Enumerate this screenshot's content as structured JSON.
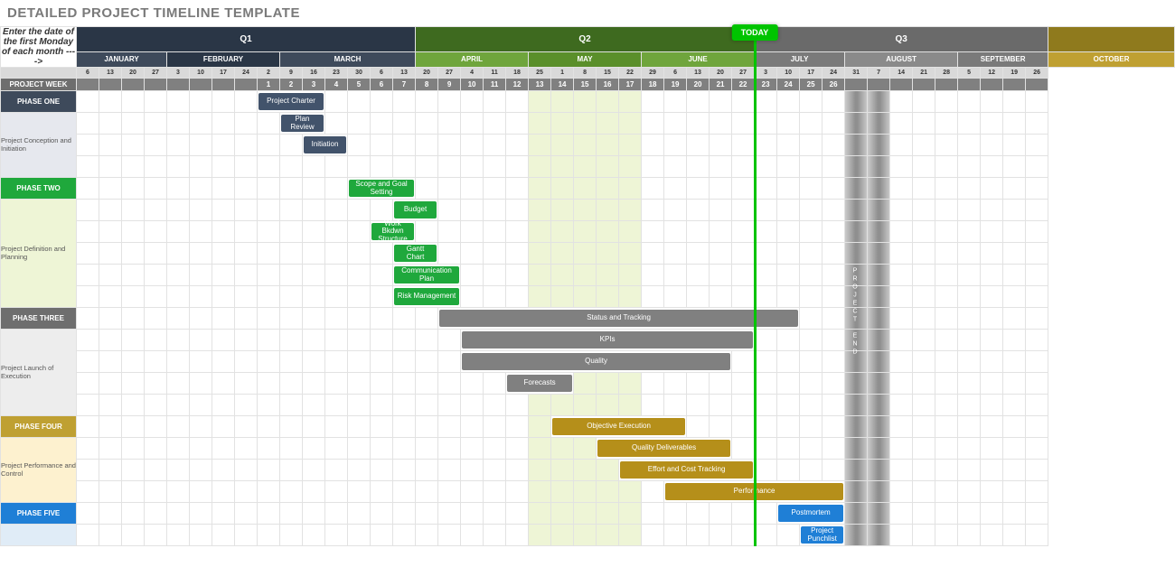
{
  "title": "DETAILED PROJECT TIMELINE TEMPLATE",
  "note": "Enter the date of the first Monday of each month ---->",
  "today": "TODAY",
  "project_week_label": "PROJECT WEEK",
  "project_end_label": "PROJECT END",
  "colors": {
    "q1": "#2a3646",
    "q2": "#3e6a1f",
    "q3": "#6a6a6a",
    "q4": "#8f7a1d",
    "m_jan": "#3e4a5b",
    "m_feb": "#2a3646",
    "m_mar": "#3e4a5b",
    "m_apr": "#6fa53c",
    "m_may": "#5a8f2a",
    "m_jun": "#6fa53c",
    "m_jul": "#7a7a7a",
    "m_aug": "#8a8a8a",
    "m_sep": "#7a7a7a",
    "m_oct": "#bfa032",
    "phase1": "#3e4a5b",
    "phase2": "#1fa83c",
    "phase3": "#6e6e6e",
    "phase4": "#bfa032",
    "phase5": "#1f7fd6",
    "bar_p1": "#42536b",
    "bar_p2": "#1fa83c",
    "bar_p3": "#808080",
    "bar_p4": "#b58f1a",
    "bar_p5": "#1f7fd6"
  },
  "quarters": [
    {
      "label": "Q1",
      "span": 15
    },
    {
      "label": "Q2",
      "span": 15
    },
    {
      "label": "Q3",
      "span": 13
    },
    {
      "label": "",
      "span": 4
    }
  ],
  "months": [
    {
      "label": "JANUARY",
      "span": 4,
      "c": "m_jan"
    },
    {
      "label": "FEBRUARY",
      "span": 5,
      "c": "m_feb"
    },
    {
      "label": "MARCH",
      "span": 6,
      "c": "m_mar"
    },
    {
      "label": "APRIL",
      "span": 5,
      "c": "m_apr"
    },
    {
      "label": "MAY",
      "span": 5,
      "c": "m_may"
    },
    {
      "label": "JUNE",
      "span": 5,
      "c": "m_jun"
    },
    {
      "label": "JULY",
      "span": 4,
      "c": "m_jul"
    },
    {
      "label": "AUGUST",
      "span": 5,
      "c": "m_aug"
    },
    {
      "label": "SEPTEMBER",
      "span": 4,
      "c": "m_sep"
    },
    {
      "label": "OCTOBER",
      "span": 4,
      "c": "m_oct"
    }
  ],
  "weeks": [
    "6",
    "13",
    "20",
    "27",
    "3",
    "10",
    "17",
    "24",
    "2",
    "9",
    "16",
    "23",
    "30",
    "6",
    "13",
    "20",
    "27",
    "4",
    "11",
    "18",
    "25",
    "1",
    "8",
    "15",
    "22",
    "29",
    "6",
    "13",
    "20",
    "27",
    "3",
    "10",
    "17",
    "24",
    "31",
    "7",
    "14",
    "21",
    "28",
    "5",
    "12",
    "19",
    "26"
  ],
  "project_weeks": [
    "",
    "",
    "",
    "",
    "",
    "",
    "",
    "",
    "1",
    "2",
    "3",
    "4",
    "5",
    "6",
    "7",
    "8",
    "9",
    "10",
    "11",
    "12",
    "13",
    "14",
    "15",
    "16",
    "17",
    "18",
    "19",
    "20",
    "21",
    "22",
    "23",
    "24",
    "25",
    "26",
    "",
    "",
    "",
    "",
    "",
    "",
    "",
    "",
    "",
    "",
    "",
    "",
    ""
  ],
  "phases": [
    {
      "name": "PHASE ONE",
      "sub": "Project Conception and Initiation",
      "style": "phase1",
      "sub_bg": "#e6e8ee",
      "tasks": [
        {
          "label": "Project Charter",
          "start": 8,
          "span": 3,
          "c": "bar_p1"
        },
        {
          "label": "Plan Review",
          "start": 9,
          "span": 2,
          "c": "bar_p1"
        },
        {
          "label": "Initiation",
          "start": 10,
          "span": 2,
          "c": "bar_p1"
        }
      ],
      "trailing": 1
    },
    {
      "name": "PHASE TWO",
      "sub": "Project Definition and Planning",
      "style": "phase2",
      "sub_bg": "#eef5d6",
      "tasks": [
        {
          "label": "Scope and Goal Setting",
          "start": 12,
          "span": 3,
          "c": "bar_p2"
        },
        {
          "label": "Budget",
          "start": 14,
          "span": 2,
          "c": "bar_p2"
        },
        {
          "label": "Work Bkdwn Structure",
          "start": 13,
          "span": 2,
          "c": "bar_p2"
        },
        {
          "label": "Gantt Chart",
          "start": 14,
          "span": 2,
          "c": "bar_p2"
        },
        {
          "label": "Communication Plan",
          "start": 14,
          "span": 3,
          "c": "bar_p2"
        },
        {
          "label": "Risk Management",
          "start": 14,
          "span": 3,
          "c": "bar_p2"
        }
      ],
      "trailing": 0
    },
    {
      "name": "PHASE THREE",
      "sub": "Project Launch of Execution",
      "style": "phase3",
      "sub_bg": "#ededed",
      "tasks": [
        {
          "label": "Status and Tracking",
          "start": 16,
          "span": 16,
          "c": "bar_p3"
        },
        {
          "label": "KPIs",
          "start": 17,
          "span": 13,
          "c": "bar_p3"
        },
        {
          "label": "Quality",
          "start": 17,
          "span": 12,
          "c": "bar_p3"
        },
        {
          "label": "Forecasts",
          "start": 19,
          "span": 3,
          "c": "bar_p3"
        }
      ],
      "trailing": 1
    },
    {
      "name": "PHASE FOUR",
      "sub": "Project Performance and Control",
      "style": "phase4",
      "sub_bg": "#fdf1cf",
      "tasks": [
        {
          "label": "Objective Execution",
          "start": 21,
          "span": 6,
          "c": "bar_p4"
        },
        {
          "label": "Quality Deliverables",
          "start": 23,
          "span": 6,
          "c": "bar_p4"
        },
        {
          "label": "Effort and Cost Tracking",
          "start": 24,
          "span": 6,
          "c": "bar_p4"
        },
        {
          "label": "Performance",
          "start": 26,
          "span": 8,
          "c": "bar_p4"
        }
      ],
      "trailing": 0
    },
    {
      "name": "PHASE FIVE",
      "sub": "",
      "style": "phase5",
      "sub_bg": "#e0ecf7",
      "tasks": [
        {
          "label": "Postmortem",
          "start": 31,
          "span": 3,
          "c": "bar_p5"
        },
        {
          "label": "Project Punchlist",
          "start": 32,
          "span": 2,
          "c": "bar_p5"
        }
      ],
      "trailing": 0
    }
  ],
  "today_col": 30,
  "may_range": [
    20,
    24
  ],
  "end_range": [
    34,
    35
  ],
  "chart_data": {
    "type": "gantt",
    "title": "DETAILED PROJECT TIMELINE TEMPLATE",
    "x_unit": "week",
    "today_week_index": 30,
    "project_end_week_index": 34,
    "weeks_header": [
      "6",
      "13",
      "20",
      "27",
      "3",
      "10",
      "17",
      "24",
      "2",
      "9",
      "16",
      "23",
      "30",
      "6",
      "13",
      "20",
      "27",
      "4",
      "11",
      "18",
      "25",
      "1",
      "8",
      "15",
      "22",
      "29",
      "6",
      "13",
      "20",
      "27",
      "3",
      "10",
      "17",
      "24",
      "31",
      "7",
      "14",
      "21",
      "28",
      "5",
      "12",
      "19",
      "26"
    ],
    "series": [
      {
        "phase": "PHASE ONE",
        "task": "Project Charter",
        "start_col": 8,
        "span": 3
      },
      {
        "phase": "PHASE ONE",
        "task": "Plan Review",
        "start_col": 9,
        "span": 2
      },
      {
        "phase": "PHASE ONE",
        "task": "Initiation",
        "start_col": 10,
        "span": 2
      },
      {
        "phase": "PHASE TWO",
        "task": "Scope and Goal Setting",
        "start_col": 12,
        "span": 3
      },
      {
        "phase": "PHASE TWO",
        "task": "Budget",
        "start_col": 14,
        "span": 2
      },
      {
        "phase": "PHASE TWO",
        "task": "Work Bkdwn Structure",
        "start_col": 13,
        "span": 2
      },
      {
        "phase": "PHASE TWO",
        "task": "Gantt Chart",
        "start_col": 14,
        "span": 2
      },
      {
        "phase": "PHASE TWO",
        "task": "Communication Plan",
        "start_col": 14,
        "span": 3
      },
      {
        "phase": "PHASE TWO",
        "task": "Risk Management",
        "start_col": 14,
        "span": 3
      },
      {
        "phase": "PHASE THREE",
        "task": "Status and Tracking",
        "start_col": 16,
        "span": 16
      },
      {
        "phase": "PHASE THREE",
        "task": "KPIs",
        "start_col": 17,
        "span": 13
      },
      {
        "phase": "PHASE THREE",
        "task": "Quality",
        "start_col": 17,
        "span": 12
      },
      {
        "phase": "PHASE THREE",
        "task": "Forecasts",
        "start_col": 19,
        "span": 3
      },
      {
        "phase": "PHASE FOUR",
        "task": "Objective Execution",
        "start_col": 21,
        "span": 6
      },
      {
        "phase": "PHASE FOUR",
        "task": "Quality Deliverables",
        "start_col": 23,
        "span": 6
      },
      {
        "phase": "PHASE FOUR",
        "task": "Effort and Cost Tracking",
        "start_col": 24,
        "span": 6
      },
      {
        "phase": "PHASE FOUR",
        "task": "Performance",
        "start_col": 26,
        "span": 8
      },
      {
        "phase": "PHASE FIVE",
        "task": "Postmortem",
        "start_col": 31,
        "span": 3
      },
      {
        "phase": "PHASE FIVE",
        "task": "Project Punchlist",
        "start_col": 32,
        "span": 2
      }
    ]
  }
}
